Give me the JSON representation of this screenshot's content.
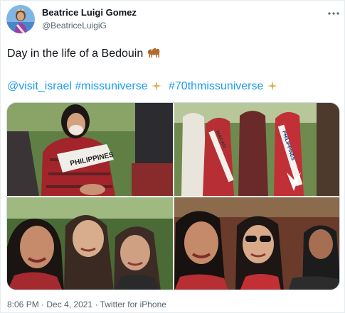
{
  "author": {
    "name": "Beatrice Luigi Gomez",
    "handle": "@BeatriceLuigiG"
  },
  "tweet": {
    "line1_text": "Day in the life of a Bedouin ",
    "line1_emoji": "camel-emoji",
    "hashtags": [
      "@visit_israel",
      "#missuniverse",
      "#70thmissuniverse"
    ],
    "sparkle_emoji": "sparkles-emoji"
  },
  "media": {
    "photos": [
      {
        "sash_text": "PHILIPPINES"
      },
      {
        "sash_text": "PHILIPPINES",
        "sash_text_2": "MACAU"
      },
      {},
      {}
    ]
  },
  "footer": {
    "time": "8:06 PM",
    "date": "Dec 4, 2021",
    "separator": "·",
    "source": "Twitter for iPhone"
  },
  "colors": {
    "link": "#1d9bf0",
    "secondary_text": "#536471",
    "border": "#cfd9de"
  }
}
